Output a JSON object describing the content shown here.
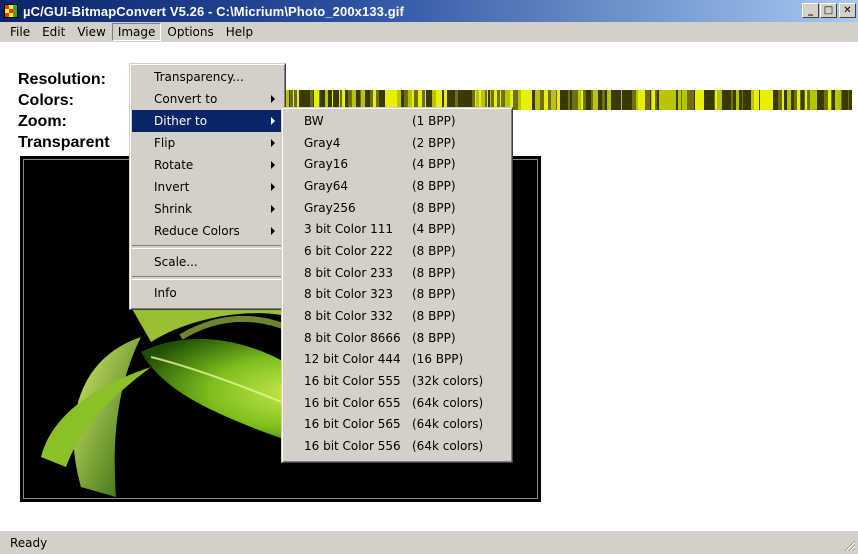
{
  "window": {
    "title": "µC/GUI-BitmapConvert V5.26 - C:\\Micrium\\Photo_200x133.gif",
    "minimize_label": "_",
    "maximize_label": "□",
    "close_label": "✕"
  },
  "menubar": {
    "items": [
      "File",
      "Edit",
      "View",
      "Image",
      "Options",
      "Help"
    ]
  },
  "info": {
    "resolution_label": "Resolution:",
    "colors_label": "Colors:",
    "zoom_label": "Zoom:",
    "transparent_label": "Transparent"
  },
  "image_menu": {
    "transparency": "Transparency...",
    "convert_to": "Convert to",
    "dither_to": "Dither to",
    "flip": "Flip",
    "rotate": "Rotate",
    "invert": "Invert",
    "shrink": "Shrink",
    "reduce_colors": "Reduce Colors",
    "scale": "Scale...",
    "info": "Info"
  },
  "dither_menu": {
    "items": [
      {
        "name": "BW",
        "bpp": "(1 BPP)"
      },
      {
        "name": "Gray4",
        "bpp": "(2 BPP)"
      },
      {
        "name": "Gray16",
        "bpp": "(4 BPP)"
      },
      {
        "name": "Gray64",
        "bpp": "(8 BPP)"
      },
      {
        "name": "Gray256",
        "bpp": "(8 BPP)"
      },
      {
        "name": "3 bit Color 111",
        "bpp": "(4 BPP)"
      },
      {
        "name": "6 bit Color 222",
        "bpp": "(8 BPP)"
      },
      {
        "name": "8 bit Color 233",
        "bpp": "(8 BPP)"
      },
      {
        "name": "8 bit Color 323",
        "bpp": "(8 BPP)"
      },
      {
        "name": "8 bit Color 332",
        "bpp": "(8 BPP)"
      },
      {
        "name": "8 bit Color 8666",
        "bpp": "(8 BPP)"
      },
      {
        "name": "12 bit Color 444",
        "bpp": "(16 BPP)"
      },
      {
        "name": "16 bit Color 555",
        "bpp": "(32k colors)"
      },
      {
        "name": "16 bit Color 655",
        "bpp": "(64k colors)"
      },
      {
        "name": "16 bit Color 565",
        "bpp": "(64k colors)"
      },
      {
        "name": "16 bit Color 556",
        "bpp": "(64k colors)"
      }
    ]
  },
  "status": {
    "text": "Ready"
  },
  "colors": {
    "title_gradient_start": "#0a246a",
    "title_gradient_end": "#a6caf0",
    "menu_bg": "#d4d0c8",
    "highlight": "#0a246a",
    "palette_dark": "#3a3a00",
    "palette_bright": "#e8f000"
  },
  "icons": {
    "app": "app-icon",
    "submenu_arrow": "chevron-right-icon",
    "resize_grip": "resize-grip-icon"
  }
}
